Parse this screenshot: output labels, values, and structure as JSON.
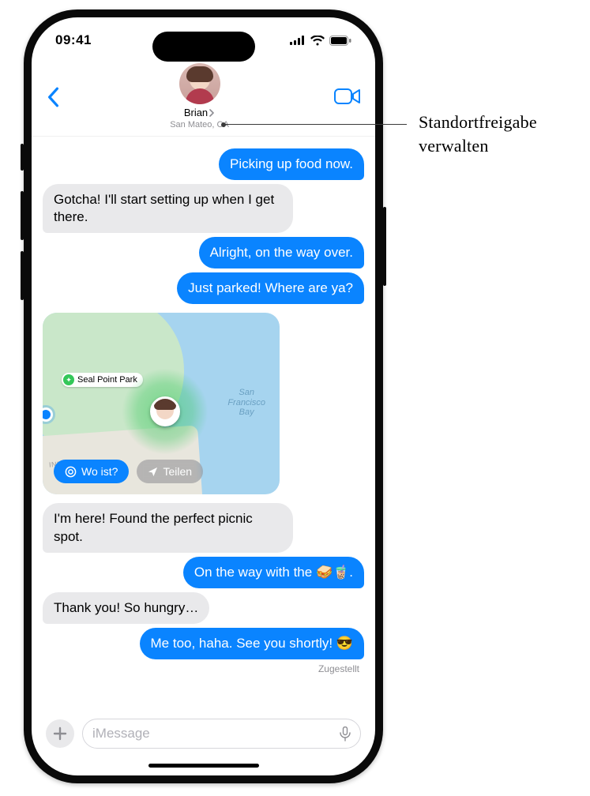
{
  "status": {
    "time": "09:41"
  },
  "header": {
    "contact_name": "Brian",
    "contact_sub": "San Mateo, CA"
  },
  "messages": [
    {
      "from": "me",
      "text": "Picking up food now."
    },
    {
      "from": "them",
      "text": "Gotcha! I'll start setting up when I get there."
    },
    {
      "from": "me",
      "text": "Alright, on the way over."
    },
    {
      "from": "me",
      "text": "Just parked! Where are ya?"
    },
    {
      "from": "them",
      "text": "I'm here! Found the perfect picnic spot."
    },
    {
      "from": "me",
      "text": "On the way with the 🥪🧋."
    },
    {
      "from": "them",
      "text": "Thank you! So hungry…"
    },
    {
      "from": "me",
      "text": "Me too, haha. See you shortly! 😎"
    }
  ],
  "receipt": "Zugestellt",
  "map": {
    "poi_label": "Seal Point Park",
    "water_label": "San\nFrancisco\nBay",
    "road_label": "INTON DR",
    "find_label": "Wo ist?",
    "share_label": "Teilen"
  },
  "input": {
    "placeholder": "iMessage"
  },
  "callout": {
    "text": "Standortfreigabe verwalten"
  }
}
